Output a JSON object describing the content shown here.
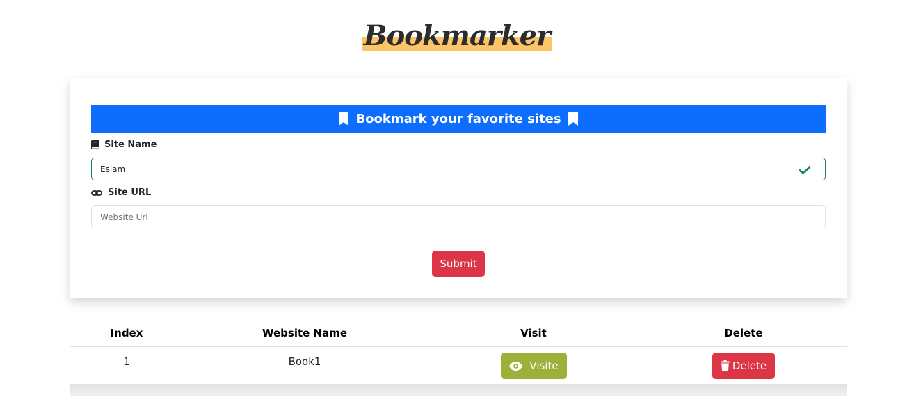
{
  "brand": {
    "title": "Bookmarker",
    "highlight_color": "#fcc568"
  },
  "form": {
    "banner": {
      "text": "Bookmark your favorite sites",
      "icon": "bookmark-icon",
      "color": "#0d6efd"
    },
    "site_name": {
      "label": "Site Name",
      "icon": "book-icon",
      "value": "Eslam",
      "valid": true
    },
    "site_url": {
      "label": "Site URL",
      "icon": "link-icon",
      "value": "",
      "placeholder": "Website Url"
    },
    "submit_label": "Submit"
  },
  "table": {
    "headers": [
      "Index",
      "Website Name",
      "Visit",
      "Delete"
    ],
    "rows": [
      {
        "index": "1",
        "name": "Book1",
        "visit_label": "Visite",
        "delete_label": "Delete"
      }
    ]
  },
  "colors": {
    "primary": "#0d6efd",
    "danger": "#dc3545",
    "visit": "#9cb03a",
    "success": "#198754"
  }
}
